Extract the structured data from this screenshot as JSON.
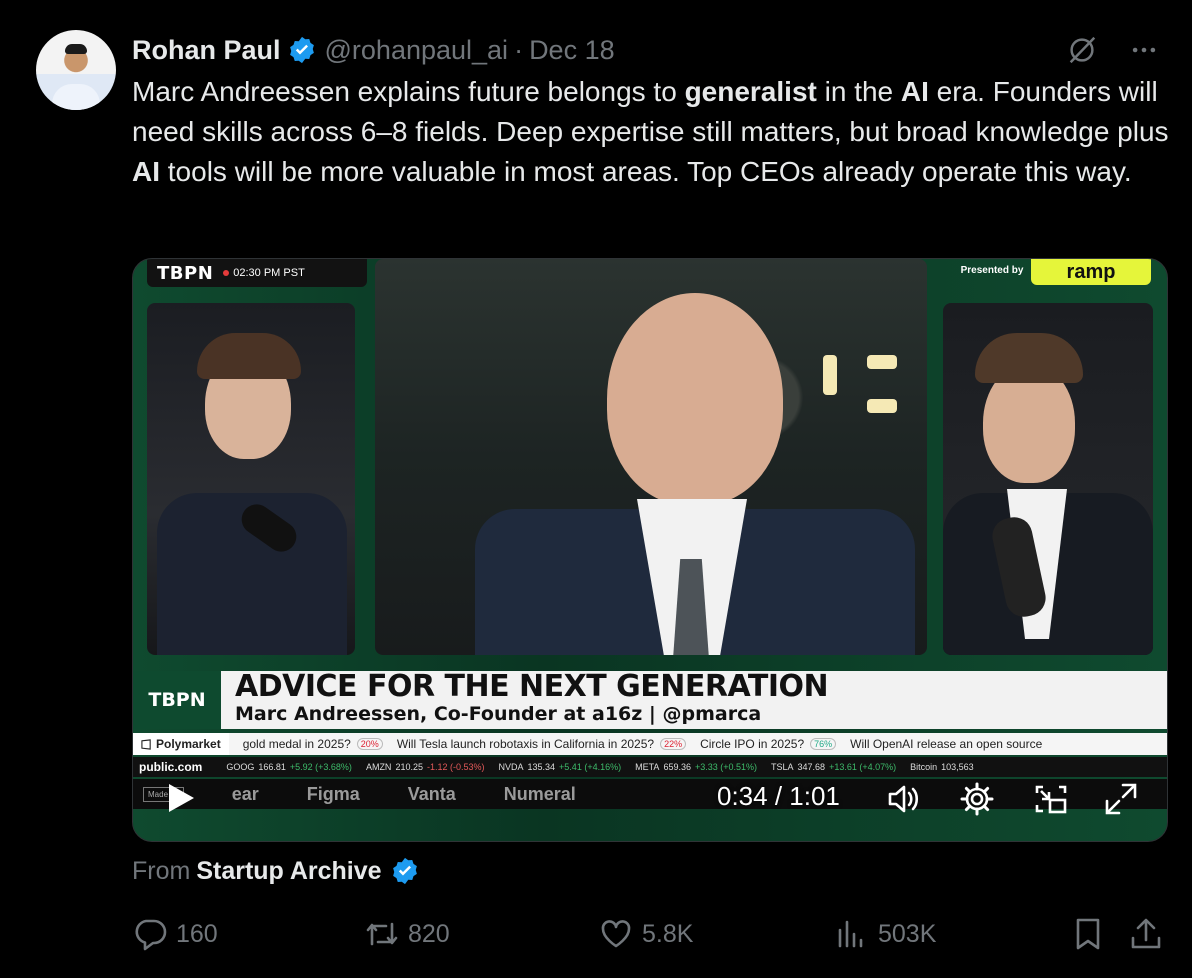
{
  "author": {
    "name": "Rohan Paul",
    "handle": "@rohanpaul_ai",
    "separator": "·",
    "date": "Dec 18"
  },
  "tweet": {
    "parts": [
      {
        "t": "Marc Andreessen explains future belongs to ",
        "b": false
      },
      {
        "t": "generalist",
        "b": true
      },
      {
        "t": " in the ",
        "b": false
      },
      {
        "t": "AI",
        "b": true
      },
      {
        "t": " era. Founders will need skills across 6–8 fields. Deep expertise still matters, but broad knowledge plus ",
        "b": false
      },
      {
        "t": "AI",
        "b": true
      },
      {
        "t": " tools will be more valuable in most areas. Top CEOs already operate this way.",
        "b": false
      }
    ]
  },
  "video": {
    "top_logo": "TBPN",
    "top_time": "02:30 PM PST",
    "presented_by": "Presented by",
    "sponsor_badge": "ramp",
    "lower_logo": "TBPN",
    "headline": "ADVICE FOR THE NEXT GENERATION",
    "subheadline": "Marc Andreessen, Co-Founder at a16z | @pmarca",
    "polymarket": {
      "brand": "Polymarket",
      "items": [
        {
          "text": "gold medal in 2025?",
          "pct": "20%"
        },
        {
          "text": "Will Tesla launch robotaxis in California in 2025?",
          "pct": "22%"
        },
        {
          "text": "Circle IPO in 2025?",
          "pct": "76%"
        },
        {
          "text": "Will OpenAI release an open source",
          "pct": ""
        }
      ]
    },
    "ticker": {
      "source": "public.com",
      "items": [
        {
          "sym": "GOOG",
          "price": "166.81",
          "chg": "+5.92 (+3.68%)",
          "dir": "up"
        },
        {
          "sym": "AMZN",
          "price": "210.25",
          "chg": "-1.12 (-0.53%)",
          "dir": "down"
        },
        {
          "sym": "NVDA",
          "price": "135.34",
          "chg": "+5.41 (+4.16%)",
          "dir": "up"
        },
        {
          "sym": "META",
          "price": "659.36",
          "chg": "+3.33 (+0.51%)",
          "dir": "up"
        },
        {
          "sym": "TSLA",
          "price": "347.68",
          "chg": "+13.61 (+4.07%)",
          "dir": "up"
        },
        {
          "sym": "Bitcoin",
          "price": "103,563",
          "chg": "",
          "dir": "up"
        }
      ]
    },
    "sponsors": [
      "Made by",
      "ear",
      "Figma",
      "Vanta",
      "Numeral"
    ],
    "timecode": "0:34 / 1:01"
  },
  "from": {
    "label": "From",
    "source": "Startup Archive"
  },
  "actions": {
    "replies": "160",
    "reposts": "820",
    "likes": "5.8K",
    "views": "503K"
  },
  "colors": {
    "background": "#000000",
    "text": "#e7e9ea",
    "muted": "#71767b",
    "verified": "#1d9bf0"
  }
}
